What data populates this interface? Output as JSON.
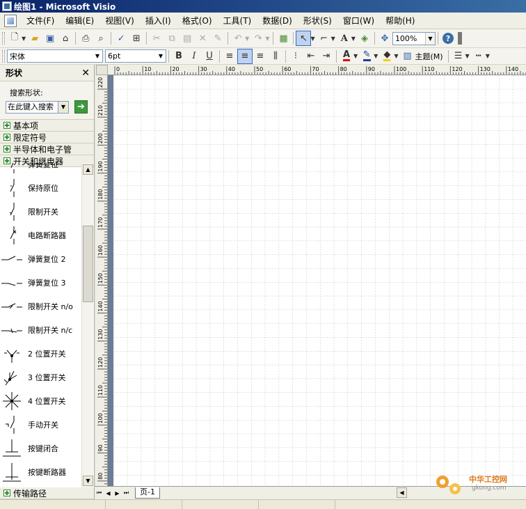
{
  "window": {
    "title": "绘图1 - Microsoft Visio"
  },
  "menu": [
    "文件(F)",
    "编辑(E)",
    "视图(V)",
    "插入(I)",
    "格式(O)",
    "工具(T)",
    "数据(D)",
    "形状(S)",
    "窗口(W)",
    "帮助(H)"
  ],
  "toolbar": {
    "zoom": "100%"
  },
  "format_toolbar": {
    "font": "宋体",
    "size": "6pt",
    "bold": "B",
    "italic": "I",
    "underline": "U",
    "text_color_glyph": "A",
    "theme_label": "主题(M)"
  },
  "shapes_panel": {
    "title": "形状",
    "search_label": "搜索形状:",
    "search_placeholder": "在此键入搜索",
    "stencils": [
      "基本项",
      "限定符号",
      "半导体和电子管",
      "开关和继电器"
    ],
    "shapes": [
      "弹簧复位",
      "保持原位",
      "限制开关",
      "电路断路器",
      "弹簧复位 2",
      "弹簧复位 3",
      "限制开关 n/o",
      "限制开关 n/c",
      "2 位置开关",
      "3 位置开关",
      "4 位置开关",
      "手动开关",
      "按键闭合",
      "按键断路器"
    ],
    "bottom_stencil": "传输路径"
  },
  "ruler": {
    "top_labels": [
      "0",
      "10",
      "20",
      "30",
      "40",
      "50",
      "60",
      "70",
      "80",
      "90",
      "100",
      "110",
      "120",
      "130",
      "140"
    ],
    "left_labels": [
      "220",
      "210",
      "200",
      "190",
      "180",
      "170",
      "160",
      "150",
      "140",
      "130",
      "120",
      "110",
      "100",
      "90",
      "80"
    ]
  },
  "page_tabs": [
    "页-1"
  ],
  "watermark": {
    "brand": "中华工控网",
    "url": "gkong.com"
  }
}
